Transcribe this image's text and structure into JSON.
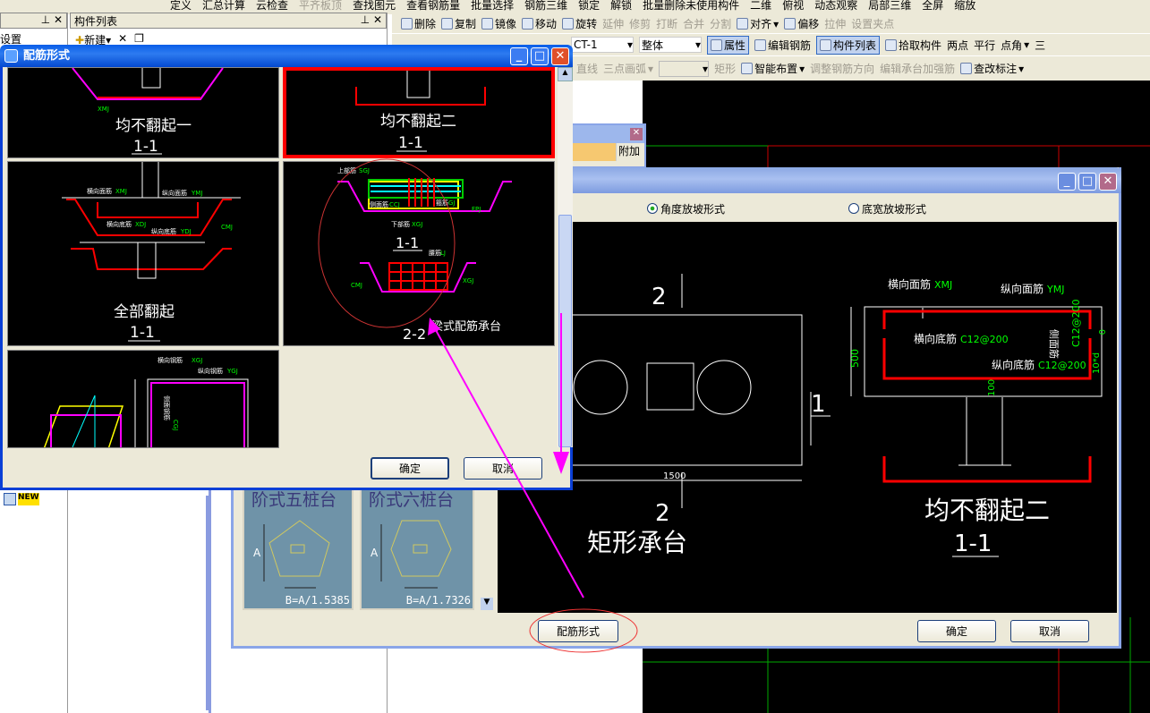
{
  "toolbar_top": [
    "定义",
    "汇总计算",
    "云检查",
    "平齐板顶",
    "查找图元",
    "查看钢筋量",
    "批量选择",
    "钢筋三维",
    "锁定",
    "解锁",
    "批量删除未使用构件",
    "二维",
    "俯视",
    "动态观察",
    "局部三维",
    "全屏",
    "缩放"
  ],
  "toolbar_edit": [
    "删除",
    "复制",
    "镜像",
    "移动",
    "旋转",
    "延伸",
    "修剪",
    "打断",
    "合并",
    "分割",
    "对齐",
    "偏移",
    "拉伸",
    "设置夹点"
  ],
  "toolbar_props": {
    "component": "CT-1",
    "scope": "整体",
    "items": [
      "属性",
      "编辑钢筋",
      "构件列表",
      "拾取构件",
      "两点",
      "平行",
      "点角",
      "三"
    ]
  },
  "toolbar_draw": [
    "直线",
    "三点画弧",
    "矩形",
    "智能布置",
    "调整钢筋方向",
    "编辑承台加强筋",
    "查改标注"
  ],
  "left_panel": {
    "title_partial": "设置",
    "new_badge": "NEW"
  },
  "component_list": {
    "title": "构件列表",
    "new_label": "新建"
  },
  "back_dialog": {
    "col_label": "附加"
  },
  "rebar_dialog": {
    "title": "配筋形式",
    "options": [
      {
        "caption": "均不翻起一",
        "section": "1-1",
        "tag": "XMJ"
      },
      {
        "caption": "均不翻起二",
        "section": "1-1",
        "selected": true
      },
      {
        "caption": "全部翻起",
        "section": "1-1",
        "labels": [
          "横向面筋",
          "XMJ",
          "纵向面筋",
          "YMJ",
          "横向底筋",
          "XDJ",
          "纵向底筋",
          "YDJ",
          "CMJ"
        ]
      },
      {
        "caption": "梁式配筋承台",
        "sections": [
          "1-1",
          "2-2"
        ],
        "labels": [
          "上部筋",
          "SGJ",
          "侧面筋",
          "CCJ",
          "箍筋",
          "GJ",
          "下部筋",
          "XGJ",
          "FPJ",
          "腰筋",
          "LJ",
          "CMJ",
          "XGJ"
        ]
      },
      {
        "labels": [
          "横向钢筋",
          "XGJ",
          "纵向钢筋",
          "YGJ",
          "侧面钢筋",
          "CGJ"
        ]
      }
    ],
    "ok": "确定",
    "cancel": "取消"
  },
  "cap_dialog": {
    "radio_angle": "角度放坡形式",
    "radio_width": "底宽放坡形式",
    "radio_selected": "角度放坡形式",
    "catalog": [
      {
        "name": "阶式五桩台",
        "formula": "B=A/1.5385",
        "dim": "A"
      },
      {
        "name": "阶式六桩台",
        "formula": "B=A/1.7326",
        "dim": "A"
      }
    ],
    "plan": {
      "title": "矩形承台",
      "mark_top": "2",
      "mark_bottom": "2",
      "mark_side": "1",
      "width": "1500"
    },
    "section": {
      "caption": "均不翻起二",
      "section": "1-1",
      "height": "500",
      "top_cover": "0",
      "side_len": "10*d",
      "bottom_cover": "100",
      "labels": {
        "xmj": "横向面筋",
        "xmj_code": "XMJ",
        "ymj": "纵向面筋",
        "ymj_code": "YMJ",
        "xdj": "横向底筋",
        "xdj_val": "C12@200",
        "ydj": "纵向底筋",
        "ydj_val": "C12@200",
        "cmj": "侧面筋",
        "cmj_val": "C12@200"
      }
    },
    "rebar_form_button": "配筋形式",
    "ok": "确定",
    "cancel": "取消"
  },
  "colors": {
    "cad_bg": "#000000",
    "rebar": "#ff0000",
    "annotation": "#ff00ff",
    "dim_text": "#00ff00",
    "xp_title": "#0a5ee8"
  }
}
